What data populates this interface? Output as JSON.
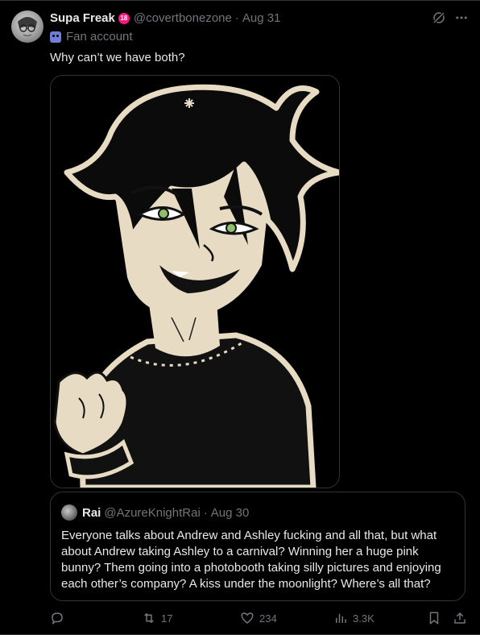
{
  "tweet": {
    "display_name": "Supa Freak",
    "badge": "18",
    "handle": "@covertbonezone",
    "date": "Aug 31",
    "label": "Fan account",
    "text": "Why can’t we have both?"
  },
  "quote": {
    "display_name": "Rai",
    "handle": "@AzureKnightRai",
    "date": "Aug 30",
    "text": "Everyone talks about Andrew and Ashley fucking and all that, but what about Andrew taking Ashley to a carnival? Winning her a huge pink bunny? Them going into a photobooth taking silly pictures and enjoying each other’s company? A kiss under the moonlight? Where’s all that?"
  },
  "actions": {
    "reply_count": "",
    "retweet_count": "17",
    "like_count": "234",
    "views_count": "3.3K"
  },
  "icons": [
    "grok-icon",
    "more-icon",
    "fan-account-label-icon",
    "reply-icon",
    "retweet-icon",
    "like-icon",
    "views-icon",
    "bookmark-icon",
    "share-icon"
  ],
  "colors": {
    "background": "#000000",
    "text_primary": "#e7e9ea",
    "text_secondary": "#71767b",
    "border": "#2f3336",
    "badge": "#f91880",
    "label_icon": "#6f7ed8",
    "art_outline": "#e7dcc3",
    "eye_green": "#8fbf6a"
  }
}
